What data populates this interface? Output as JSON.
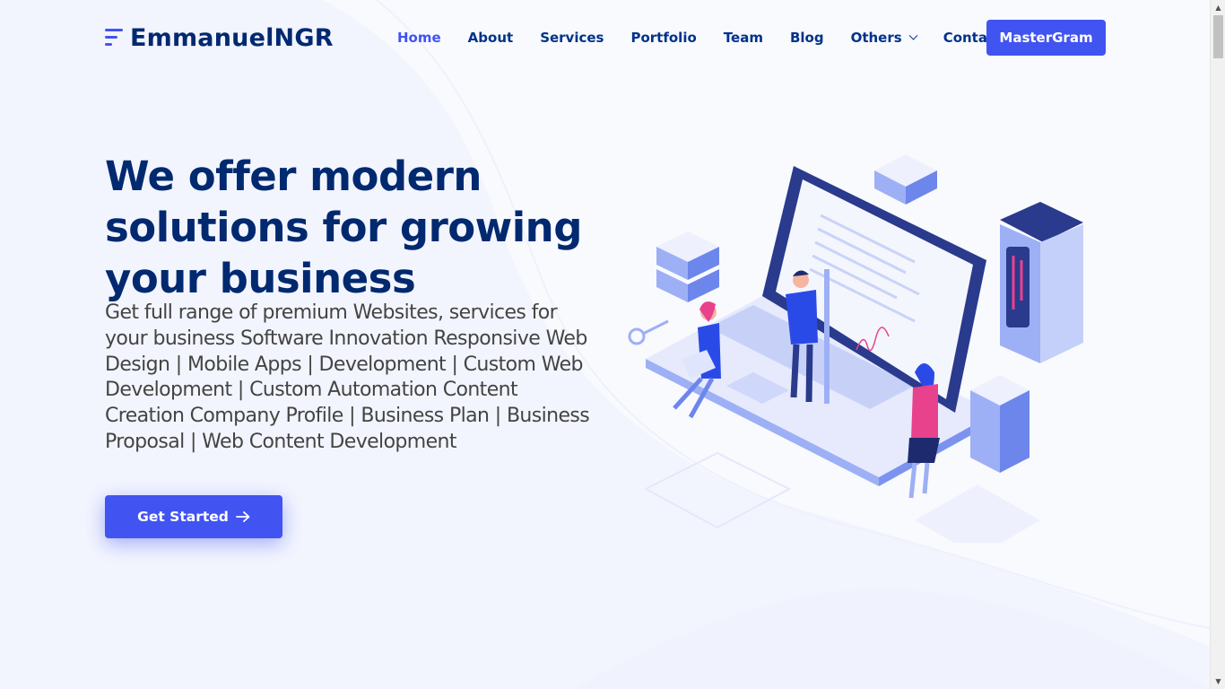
{
  "brand": {
    "name": "EmmanuelNGR",
    "accent": "#4154f1",
    "navy": "#012970"
  },
  "nav": {
    "items": [
      {
        "label": "Home",
        "active": true
      },
      {
        "label": "About"
      },
      {
        "label": "Services"
      },
      {
        "label": "Portfolio"
      },
      {
        "label": "Team"
      },
      {
        "label": "Blog"
      },
      {
        "label": "Others",
        "has_dropdown": true,
        "icon": "chevron-down-icon"
      },
      {
        "label": "Contact"
      }
    ],
    "cta_label": "MasterGram"
  },
  "hero": {
    "title": "We offer modern solutions for growing your business",
    "subtitle": "Get full range of premium Websites, services for your business Software Innovation Responsive Web Design | Mobile Apps | Development | Custom Web Development | Custom Automation Content Creation Company Profile | Business Plan | Business Proposal | Web Content Development",
    "button_label": "Get Started",
    "button_icon": "arrow-right-icon",
    "illustration": "hero-illustration-laptop-team"
  }
}
